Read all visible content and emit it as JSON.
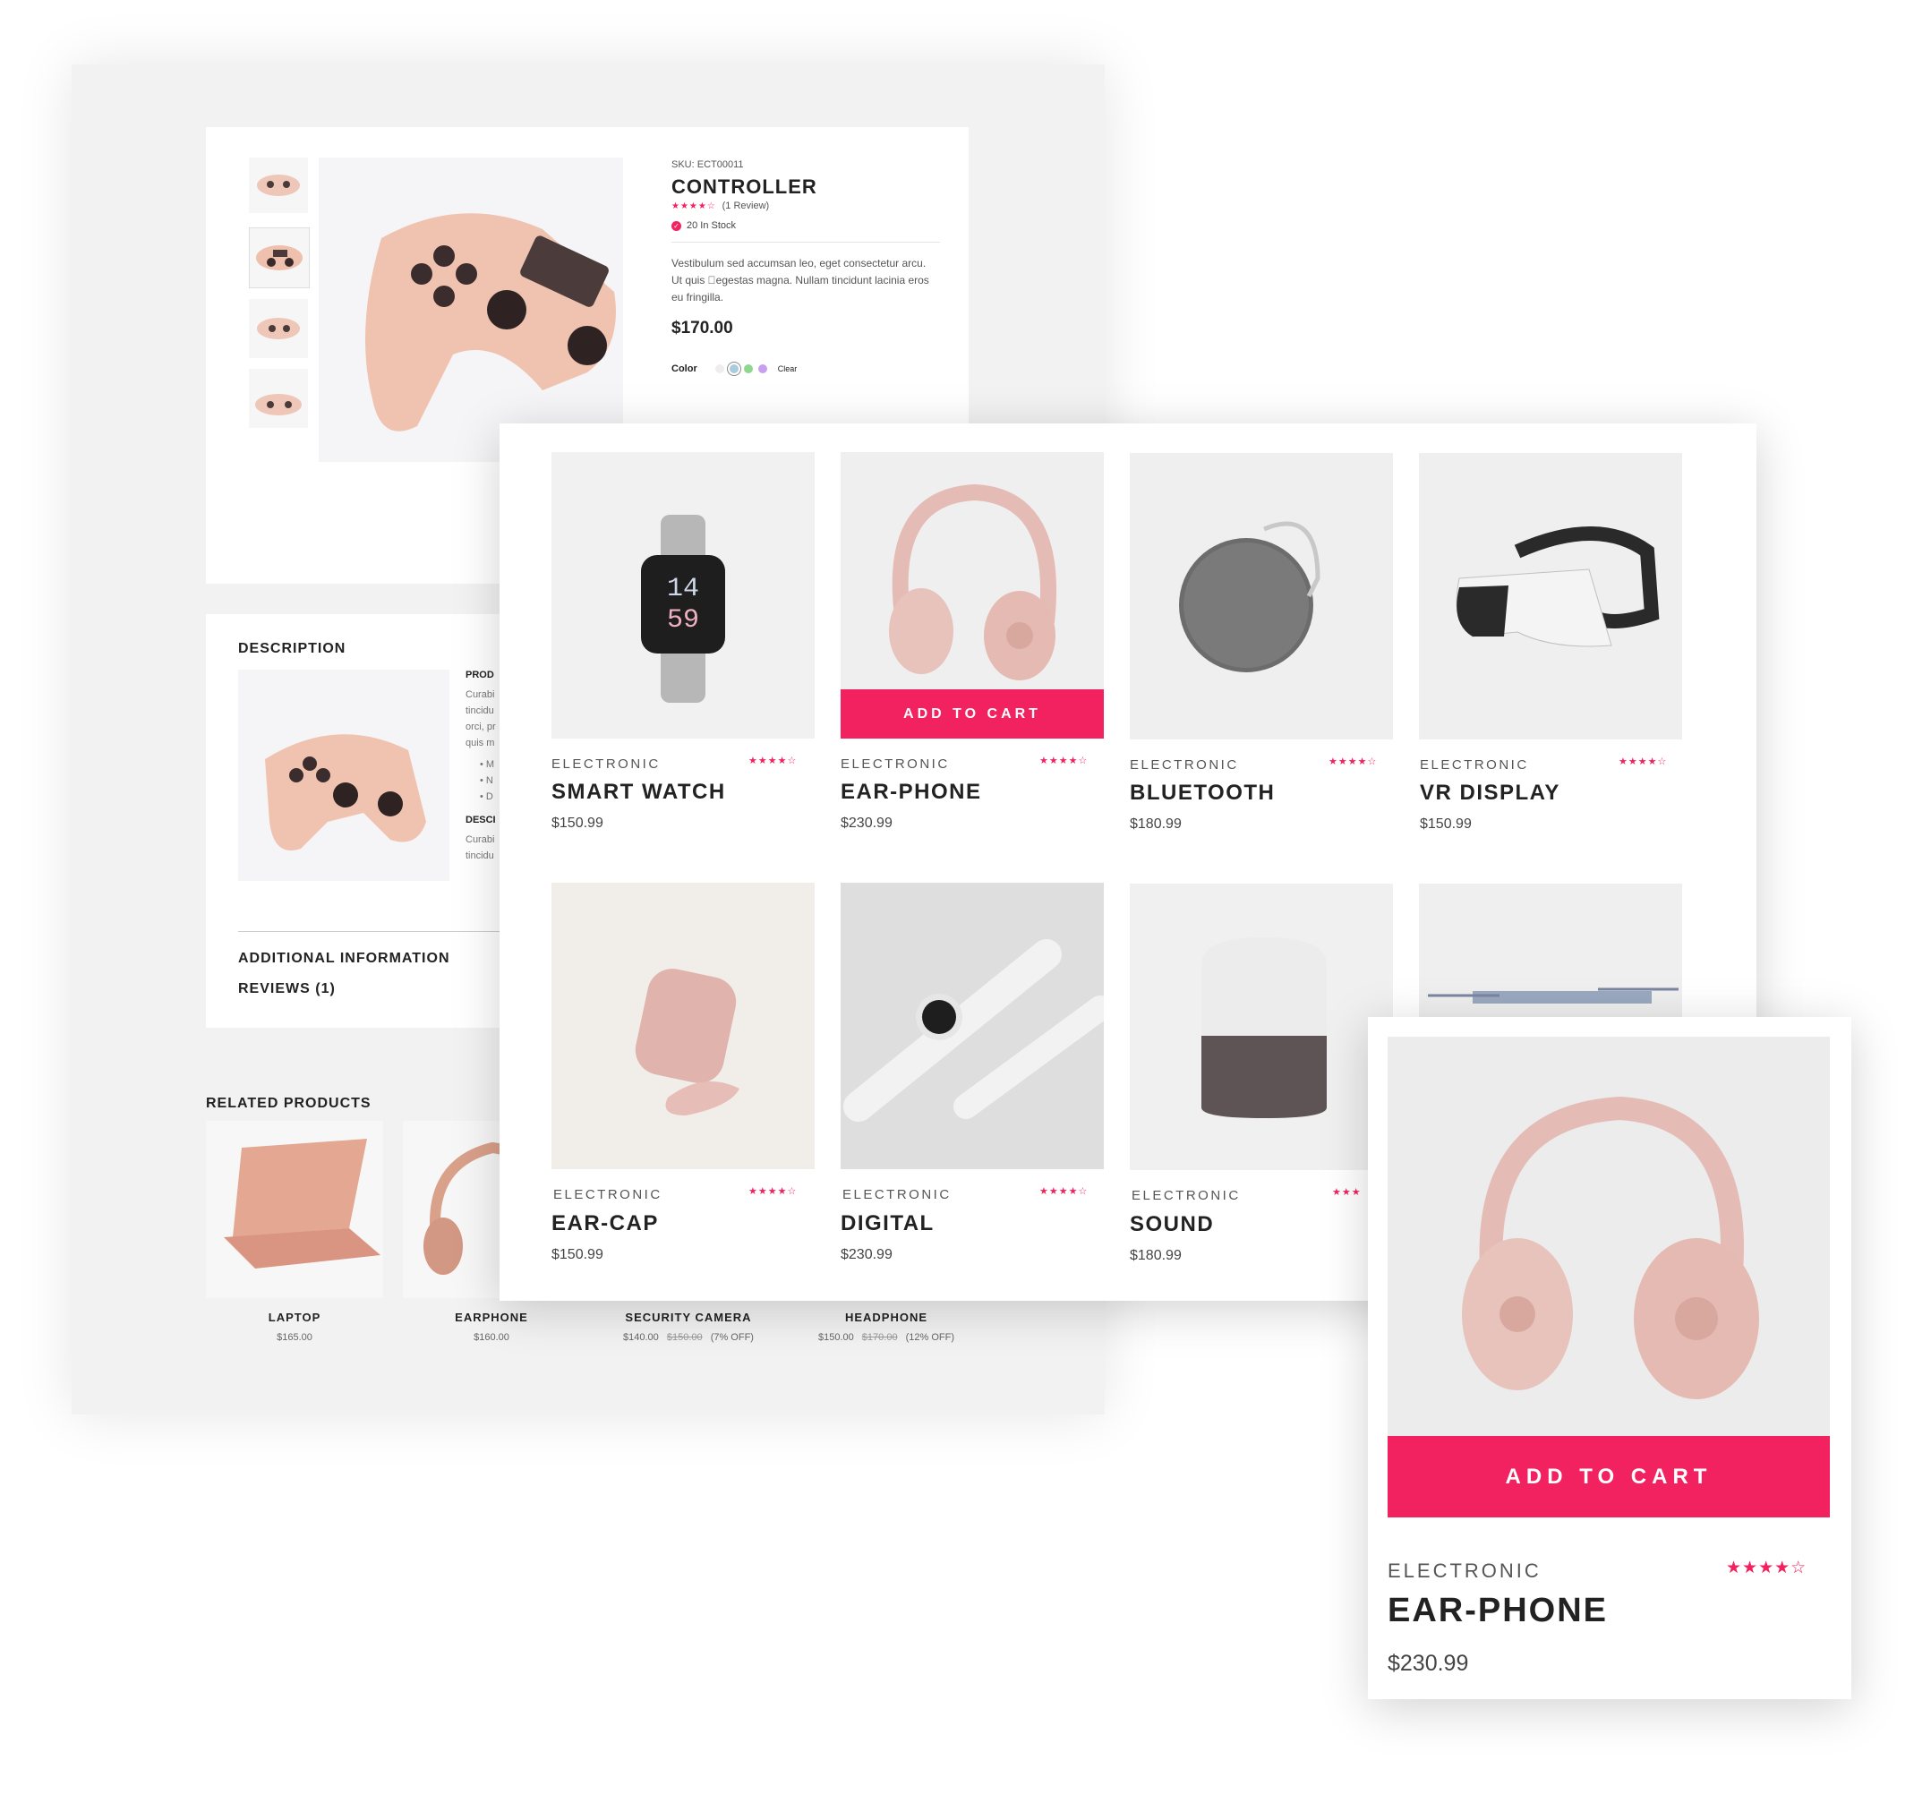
{
  "product": {
    "sku_label": "SKU:",
    "sku": "ECT00011",
    "title": "CONTROLLER",
    "stars": "★★★★☆",
    "reviews": "(1 Review)",
    "stock": "20 In Stock",
    "description": "Vestibulum sed accumsan leo, eget consectetur arcu. Ut quis \u0000egestas magna. Nullam tincidunt lacinia eros eu fringilla.",
    "price": "$170.00",
    "color_label": "Color",
    "color_swatches": [
      "#eeeeee",
      "#a9cbe0",
      "#8fd68f",
      "#c79ff0"
    ],
    "clear_label": "Clear"
  },
  "details": {
    "description_heading": "DESCRIPTION",
    "desc_sub1": "PROD",
    "desc_lines": [
      "Curabi",
      "tincidu",
      "orci, pr",
      "quis m"
    ],
    "bullets": [
      "M",
      "N",
      "D"
    ],
    "desc_sub2": "DESCI",
    "desc_lines2": [
      "Curabi",
      "tincidu"
    ],
    "additional_info": "ADDITIONAL INFORMATION",
    "reviews_tab": "REVIEWS (1)"
  },
  "related": {
    "heading": "RELATED PRODUCTS",
    "items": [
      {
        "name": "LAPTOP",
        "price": "$165.00",
        "old": "",
        "off": ""
      },
      {
        "name": "EARPHONE",
        "price": "$160.00",
        "old": "",
        "off": ""
      },
      {
        "name": "SECURITY CAMERA",
        "price": "$140.00",
        "old": "$150.00",
        "off": "(7% OFF)"
      },
      {
        "name": "HEADPHONE",
        "price": "$150.00",
        "old": "$170.00",
        "off": "(12% OFF)"
      }
    ]
  },
  "grid": {
    "add_to_cart": "ADD TO CART",
    "items": [
      {
        "category": "ELECTRONIC",
        "name": "SMART WATCH",
        "price": "$150.99",
        "stars": "★★★★☆"
      },
      {
        "category": "ELECTRONIC",
        "name": "EAR-PHONE",
        "price": "$230.99",
        "stars": "★★★★☆"
      },
      {
        "category": "ELECTRONIC",
        "name": "BLUETOOTH",
        "price": "$180.99",
        "stars": "★★★★☆"
      },
      {
        "category": "ELECTRONIC",
        "name": "VR DISPLAY",
        "price": "$150.99",
        "stars": "★★★★☆"
      },
      {
        "category": "ELECTRONIC",
        "name": "EAR-CAP",
        "price": "$150.99",
        "stars": "★★★★☆"
      },
      {
        "category": "ELECTRONIC",
        "name": "DIGITAL",
        "price": "$230.99",
        "stars": "★★★★☆"
      },
      {
        "category": "ELECTRONIC",
        "name": "SOUND",
        "price": "$180.99",
        "stars": "★★★"
      }
    ]
  },
  "featured": {
    "category": "ELECTRONIC",
    "name": "EAR-PHONE",
    "price": "$230.99",
    "stars": "★★★★☆",
    "add_to_cart": "ADD TO CART"
  },
  "colors": {
    "accent": "#f2215f",
    "panel": "#f2f2f2"
  }
}
